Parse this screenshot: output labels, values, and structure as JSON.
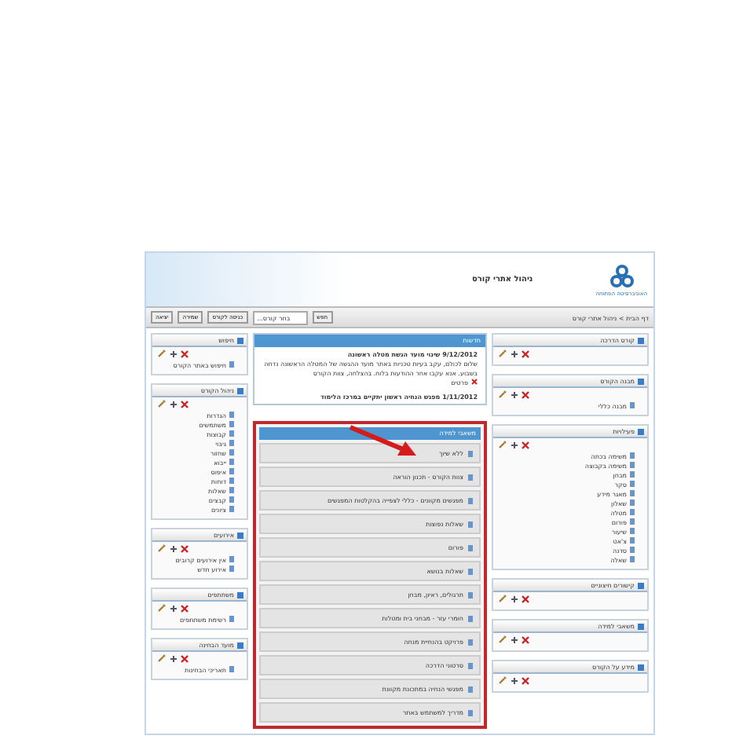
{
  "header": {
    "logo_text": "האוניברסיטה הפתוחה",
    "title": "ניהול אתרי קורס"
  },
  "toolbar": {
    "breadcrumb": "דף הבית > ניהול אתרי קורס",
    "search_button": "חפש",
    "select_placeholder": "בחר קורס...",
    "buttons": [
      "כניסה לקורס",
      "שמירה",
      "יציאה"
    ]
  },
  "right_panels": [
    {
      "title": "קורס הדרכה"
    },
    {
      "title": "מבנה הקורס",
      "items": [
        {
          "label": "מבנה כללי"
        }
      ]
    },
    {
      "title": "פעילויות",
      "items": [
        {
          "label": "משימה בכתה"
        },
        {
          "label": "משימה בקבוצה"
        },
        {
          "label": "מבחן"
        },
        {
          "label": "סקר"
        },
        {
          "label": "מאגר מידע"
        },
        {
          "label": "שאלון"
        },
        {
          "label": "מטלה"
        },
        {
          "label": "פורום"
        },
        {
          "label": "שיעור"
        },
        {
          "label": "צ'אט"
        },
        {
          "label": "סדנה"
        },
        {
          "label": "שאלה"
        }
      ]
    },
    {
      "title": "קישורים חיצוניים"
    },
    {
      "title": "משאבי למידה"
    },
    {
      "title": "מידע על הקורס"
    }
  ],
  "center": {
    "news": {
      "title": "חדשות",
      "entries": [
        {
          "headline": "9/12/2012 שינוי מועד הגשת מטלה ראשונה",
          "body": "שלום לכולם, עקב בעיות טכניות באתר מועד ההגשה של המטלה הראשונה נדחה בשבוע. אנא עקבו אחר ההודעות בלוח. בהצלחה, צוות הקורס",
          "link": "פרטים"
        },
        {
          "headline": "1/11/2012 מפגש הנחיה ראשון יתקיים במרכז הלימוד"
        }
      ]
    },
    "resources": {
      "title": "משאבי למידה",
      "items": [
        {
          "label": "ללא שיוך"
        },
        {
          "label": "צוות הקורס - תכנון הוראה"
        },
        {
          "label": "מפגשים מקוונים - כללי לצפייה בהקלטות המפגשים"
        },
        {
          "label": "שאלות נפוצות"
        },
        {
          "label": "פורום"
        },
        {
          "label": "שאלות בנושא"
        },
        {
          "label": "תרגולים, ראיון, מבחן"
        },
        {
          "label": "חומרי עזר - מבחני בית ומטלות"
        },
        {
          "label": "פרויקט בהנחיית מנחה"
        },
        {
          "label": "סרטוני הדרכה"
        },
        {
          "label": "מפגשי הנחיה במתכונת מקוונת"
        },
        {
          "label": "מדריך למשתמש באתר"
        }
      ]
    }
  },
  "left_panels": [
    {
      "title": "חיפוש",
      "items": [
        {
          "label": "חיפוש באתר הקורס"
        }
      ]
    },
    {
      "title": "ניהול הקורס",
      "items": [
        {
          "label": "הגדרות"
        },
        {
          "label": "משתמשים"
        },
        {
          "label": "קבוצות"
        },
        {
          "label": "גיבוי"
        },
        {
          "label": "שחזור"
        },
        {
          "label": "ייבוא"
        },
        {
          "label": "איפוס"
        },
        {
          "label": "דוחות"
        },
        {
          "label": "שאלות"
        },
        {
          "label": "קבצים"
        },
        {
          "label": "ציונים"
        }
      ]
    },
    {
      "title": "אירועים",
      "items": [
        {
          "label": "אין אירועים קרובים"
        },
        {
          "label": "אירוע חדש"
        }
      ]
    },
    {
      "title": "משתתפים",
      "items": [
        {
          "label": "רשימת משתתפים"
        }
      ]
    },
    {
      "title": "מועד הבחינה",
      "items": [
        {
          "label": "תאריכי הבחינות"
        }
      ]
    }
  ]
}
